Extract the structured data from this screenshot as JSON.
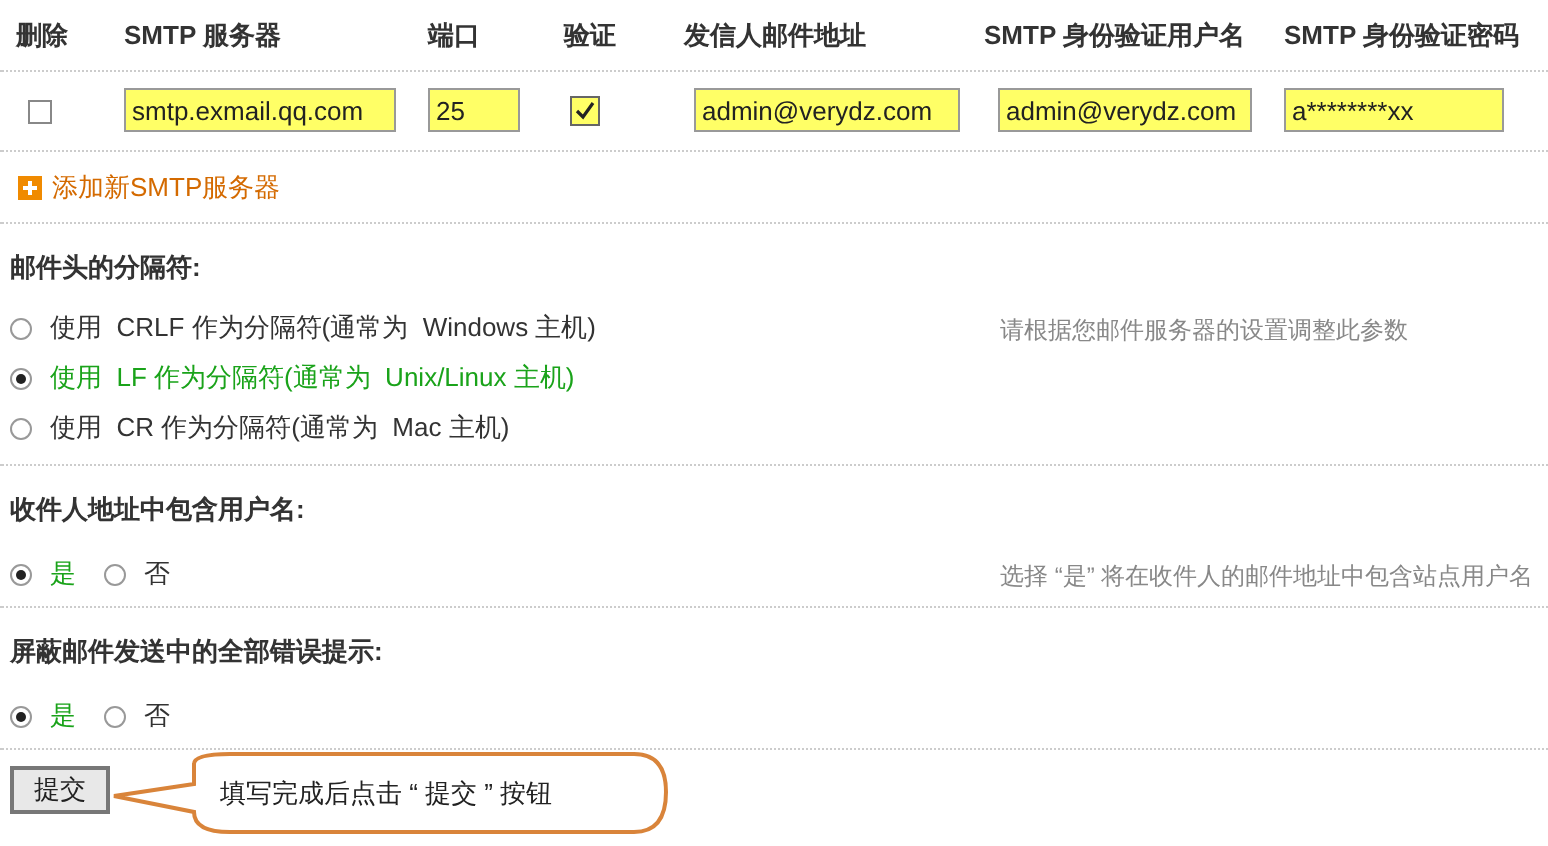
{
  "smtp_table": {
    "columns": [
      "删除",
      "SMTP 服务器",
      "端口",
      "验证",
      "发信人邮件地址",
      "SMTP 身份验证用户名",
      "SMTP 身份验证密码"
    ],
    "rows": [
      {
        "delete_checked": false,
        "server": "smtp.exmail.qq.com",
        "port": "25",
        "auth_checked": true,
        "sender": "admin@verydz.com",
        "username": "admin@verydz.com",
        "password": "a********xx"
      }
    ],
    "add_link": "添加新SMTP服务器"
  },
  "sections": [
    {
      "title": "邮件头的分隔符:",
      "kind": "vertical",
      "hint": "请根据您邮件服务器的设置调整此参数",
      "options": [
        {
          "label": "使用  CRLF 作为分隔符(通常为  Windows 主机)",
          "selected": false
        },
        {
          "label": "使用  LF 作为分隔符(通常为  Unix/Linux 主机)",
          "selected": true
        },
        {
          "label": "使用  CR 作为分隔符(通常为  Mac 主机)",
          "selected": false
        }
      ]
    },
    {
      "title": "收件人地址中包含用户名:",
      "kind": "inline",
      "hint": "选择 “是” 将在收件人的邮件地址中包含站点用户名",
      "options": [
        {
          "label": "是",
          "selected": true
        },
        {
          "label": "否",
          "selected": false
        }
      ]
    },
    {
      "title": "屏蔽邮件发送中的全部错误提示:",
      "kind": "inline",
      "options": [
        {
          "label": "是",
          "selected": true
        },
        {
          "label": "否",
          "selected": false
        }
      ]
    }
  ],
  "submit_button": "提交",
  "callout": "填写完成后点击 “ 提交 ” 按钮"
}
